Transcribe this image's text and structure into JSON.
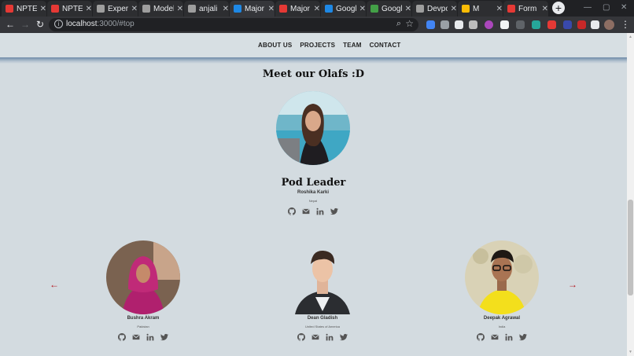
{
  "browser": {
    "tabs": [
      {
        "title": "NPTEL",
        "color": "#e53935"
      },
      {
        "title": "NPTEL",
        "color": "#e53935"
      },
      {
        "title": "Experiences",
        "color": "#9e9e9e"
      },
      {
        "title": "Models",
        "color": "#9e9e9e"
      },
      {
        "title": "anjali",
        "color": "#9e9e9e"
      },
      {
        "title": "Major",
        "color": "#1e88e5"
      },
      {
        "title": "Major",
        "color": "#e53935"
      },
      {
        "title": "Google",
        "color": "#1e88e5"
      },
      {
        "title": "Google",
        "color": "#43a047"
      },
      {
        "title": "Devpost",
        "color": "#9e9e9e"
      },
      {
        "title": "M",
        "color": "#fbbc05"
      },
      {
        "title": "Form",
        "color": "#e53935"
      }
    ],
    "url_host": "localhost",
    "url_path": ":3000/#top"
  },
  "site": {
    "nav": [
      "ABOUT US",
      "PROJECTS",
      "TEAM",
      "CONTACT"
    ],
    "heading": "Meet our Olafs :D",
    "lead": {
      "title": "Pod Leader",
      "name": "Roshika Karki",
      "country": "Nepal"
    },
    "members": [
      {
        "name": "Bushra Akram",
        "country": "Pakistan"
      },
      {
        "name": "Dean Gladish",
        "country": "United States of America"
      },
      {
        "name": "Deepak Agrawal",
        "country": "India"
      }
    ],
    "social_icons": [
      "github-icon",
      "email-icon",
      "linkedin-icon",
      "twitter-icon"
    ]
  }
}
